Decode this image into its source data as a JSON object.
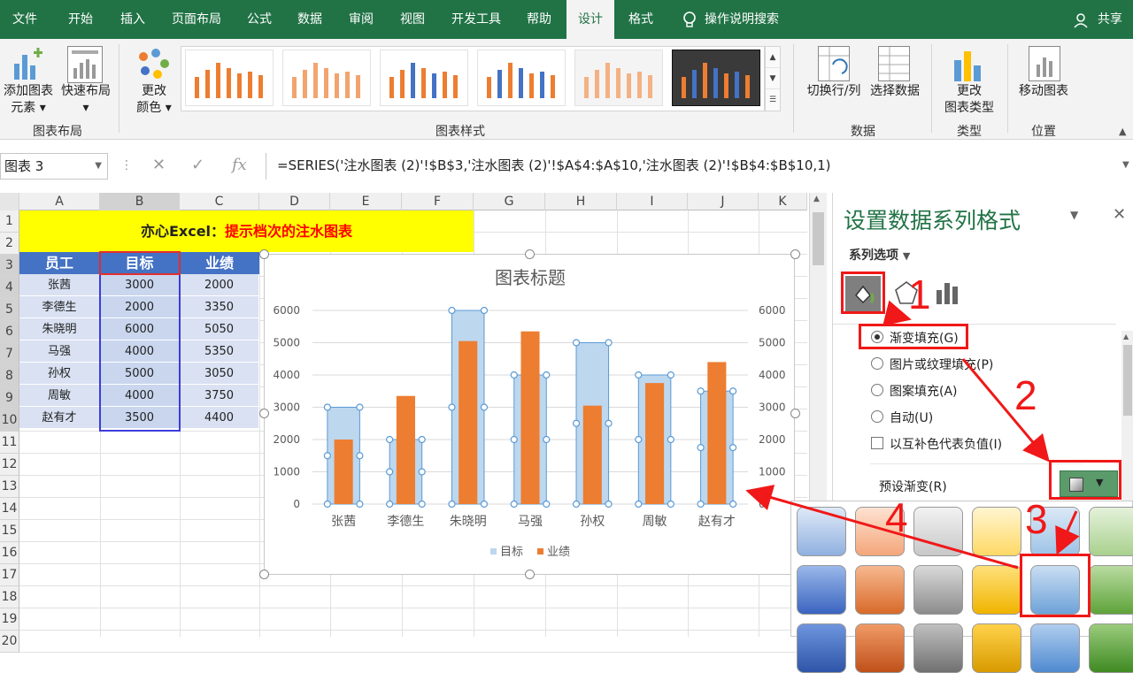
{
  "tabs": [
    "文件",
    "开始",
    "插入",
    "页面布局",
    "公式",
    "数据",
    "审阅",
    "视图",
    "开发工具",
    "帮助",
    "设计",
    "格式"
  ],
  "tell_me": "操作说明搜索",
  "share": "共享",
  "ribbon": {
    "add_element": "添加图表",
    "add_element2": "元素",
    "quick_layout": "快速布局",
    "change_colors": "更改",
    "change_colors2": "颜色",
    "group_layout": "图表布局",
    "group_styles": "图表样式",
    "switch_rowcol": "切换行/列",
    "select_data": "选择数据",
    "group_data": "数据",
    "change_type": "更改",
    "change_type2": "图表类型",
    "group_type": "类型",
    "move_chart": "移动图表",
    "group_location": "位置"
  },
  "namebox": "图表 3",
  "formula": "=SERIES('注水图表 (2)'!$B$3,'注水图表 (2)'!$A$4:$A$10,'注水图表 (2)'!$B$4:$B$10,1)",
  "columns": [
    "A",
    "B",
    "C",
    "D",
    "E",
    "F",
    "G",
    "H",
    "I",
    "J",
    "K"
  ],
  "rows": [
    "1",
    "2",
    "3",
    "4",
    "5",
    "6",
    "7",
    "8",
    "9",
    "10",
    "11",
    "12",
    "13",
    "14",
    "15",
    "16",
    "17",
    "18",
    "19",
    "20"
  ],
  "sheet": {
    "title_black": "亦心Excel：",
    "title_red": "提示档次的注水图表",
    "headers": [
      "员工",
      "目标",
      "业绩"
    ],
    "data": [
      [
        "张茜",
        "3000",
        "2000"
      ],
      [
        "李德生",
        "2000",
        "3350"
      ],
      [
        "朱晓明",
        "6000",
        "5050"
      ],
      [
        "马强",
        "4000",
        "5350"
      ],
      [
        "孙权",
        "5000",
        "3050"
      ],
      [
        "周敏",
        "4000",
        "3750"
      ],
      [
        "赵有才",
        "3500",
        "4400"
      ]
    ]
  },
  "chart_data": {
    "type": "bar",
    "title": "图表标题",
    "categories": [
      "张茜",
      "李德生",
      "朱晓明",
      "马强",
      "孙权",
      "周敏",
      "赵有才"
    ],
    "series": [
      {
        "name": "目标",
        "values": [
          3000,
          2000,
          6000,
          4000,
          5000,
          4000,
          3500
        ]
      },
      {
        "name": "业绩",
        "values": [
          2000,
          3350,
          5050,
          5350,
          3050,
          3750,
          4400
        ]
      }
    ],
    "ylim": [
      0,
      6000
    ],
    "yticks": [
      "0",
      "1000",
      "2000",
      "3000",
      "4000",
      "5000",
      "6000"
    ],
    "legend": "bottom",
    "colors": {
      "target": "#bdd7ee",
      "actual": "#ed7d31"
    }
  },
  "pane": {
    "title": "设置数据系列格式",
    "series_options": "系列选项",
    "options": [
      "渐变填充(G)",
      "图片或纹理填充(P)",
      "图案填充(A)",
      "自动(U)"
    ],
    "invert": "以互补色代表负值(I)",
    "preset": "预设渐变(R)"
  },
  "annotations": [
    "1",
    "2",
    "3",
    "4"
  ]
}
